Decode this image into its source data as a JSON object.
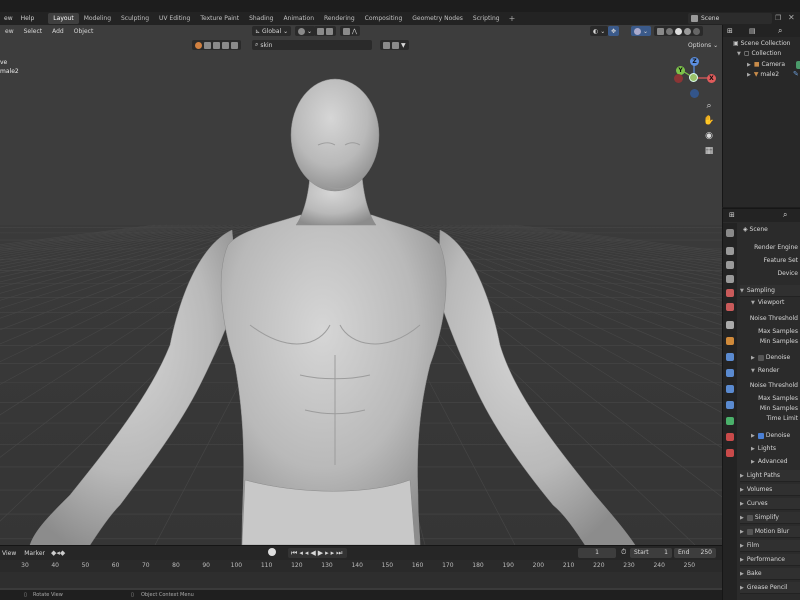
{
  "menu": [
    "ew",
    "Help"
  ],
  "workspaces": [
    {
      "label": "Layout",
      "active": true
    },
    {
      "label": "Modeling",
      "active": false
    },
    {
      "label": "Sculpting",
      "active": false
    },
    {
      "label": "UV Editing",
      "active": false
    },
    {
      "label": "Texture Paint",
      "active": false
    },
    {
      "label": "Shading",
      "active": false
    },
    {
      "label": "Animation",
      "active": false
    },
    {
      "label": "Rendering",
      "active": false
    },
    {
      "label": "Compositing",
      "active": false
    },
    {
      "label": "Geometry Nodes",
      "active": false
    },
    {
      "label": "Scripting",
      "active": false
    }
  ],
  "add_workspace": "+",
  "scene_name": "Scene",
  "viewport": {
    "menus": [
      "ew",
      "Select",
      "Add",
      "Object"
    ],
    "orientation": "Global",
    "search_value": "skin",
    "options_label": "Options",
    "info_line1": "ve",
    "info_line2": "male2"
  },
  "gizmo": {
    "z": "Z",
    "y": "Y",
    "x": "X"
  },
  "outliner": {
    "root": "Scene Collection",
    "collection": "Collection",
    "items": [
      "Camera",
      "male2"
    ]
  },
  "properties": {
    "scene_label": "Scene",
    "fields": [
      "Render Engine",
      "Feature Set",
      "Device"
    ],
    "sampling": "Sampling",
    "viewport_sub": "Viewport",
    "noise_threshold": "Noise Threshold",
    "max_samples": "Max Samples",
    "min_samples": "Min Samples",
    "denoise": "Denoise",
    "render_sub": "Render",
    "time_limit": "Time Limit",
    "lights": "Lights",
    "advanced": "Advanced",
    "sections": [
      "Light Paths",
      "Volumes",
      "Curves",
      "Simplify",
      "Motion Blur",
      "Film",
      "Performance",
      "Bake",
      "Grease Pencil"
    ]
  },
  "timeline": {
    "menus": [
      "View",
      "Marker"
    ],
    "current_frame": "1",
    "start_label": "Start",
    "start_value": "1",
    "end_label": "End",
    "end_value": "250",
    "ticks": [
      "30",
      "40",
      "50",
      "60",
      "70",
      "80",
      "90",
      "100",
      "110",
      "120",
      "130",
      "140",
      "150",
      "160",
      "170",
      "180",
      "190",
      "200",
      "210",
      "220",
      "230",
      "240",
      "250"
    ]
  },
  "status": {
    "left": "Rotate View",
    "middle": "Object Context Menu"
  }
}
